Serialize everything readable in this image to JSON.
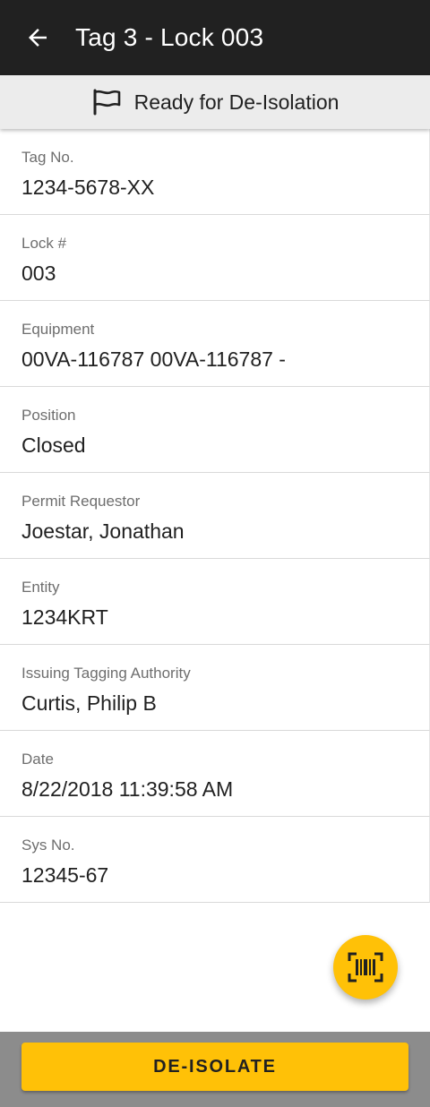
{
  "header": {
    "title": "Tag 3 - Lock 003",
    "back_icon": "arrow-back-icon"
  },
  "status": {
    "text": "Ready for De-Isolation",
    "icon": "flag-icon"
  },
  "details": [
    {
      "label": "Tag No.",
      "value": "1234-5678-XX"
    },
    {
      "label": "Lock #",
      "value": "003"
    },
    {
      "label": "Equipment",
      "value": "00VA-116787 00VA-116787 -"
    },
    {
      "label": "Position",
      "value": "Closed"
    },
    {
      "label": "Permit Requestor",
      "value": "Joestar, Jonathan"
    },
    {
      "label": "Entity",
      "value": "1234KRT"
    },
    {
      "label": "Issuing Tagging Authority",
      "value": "Curtis, Philip B"
    },
    {
      "label": "Date",
      "value": "8/22/2018 11:39:58 AM"
    },
    {
      "label": "Sys No.",
      "value": "12345-67"
    }
  ],
  "fab": {
    "icon": "barcode-scan-icon"
  },
  "footer": {
    "action_label": "DE-ISOLATE"
  },
  "colors": {
    "appbar": "#212121",
    "accent": "#ffc107",
    "status_bar": "#ececec",
    "footer": "#8c8c8c"
  }
}
